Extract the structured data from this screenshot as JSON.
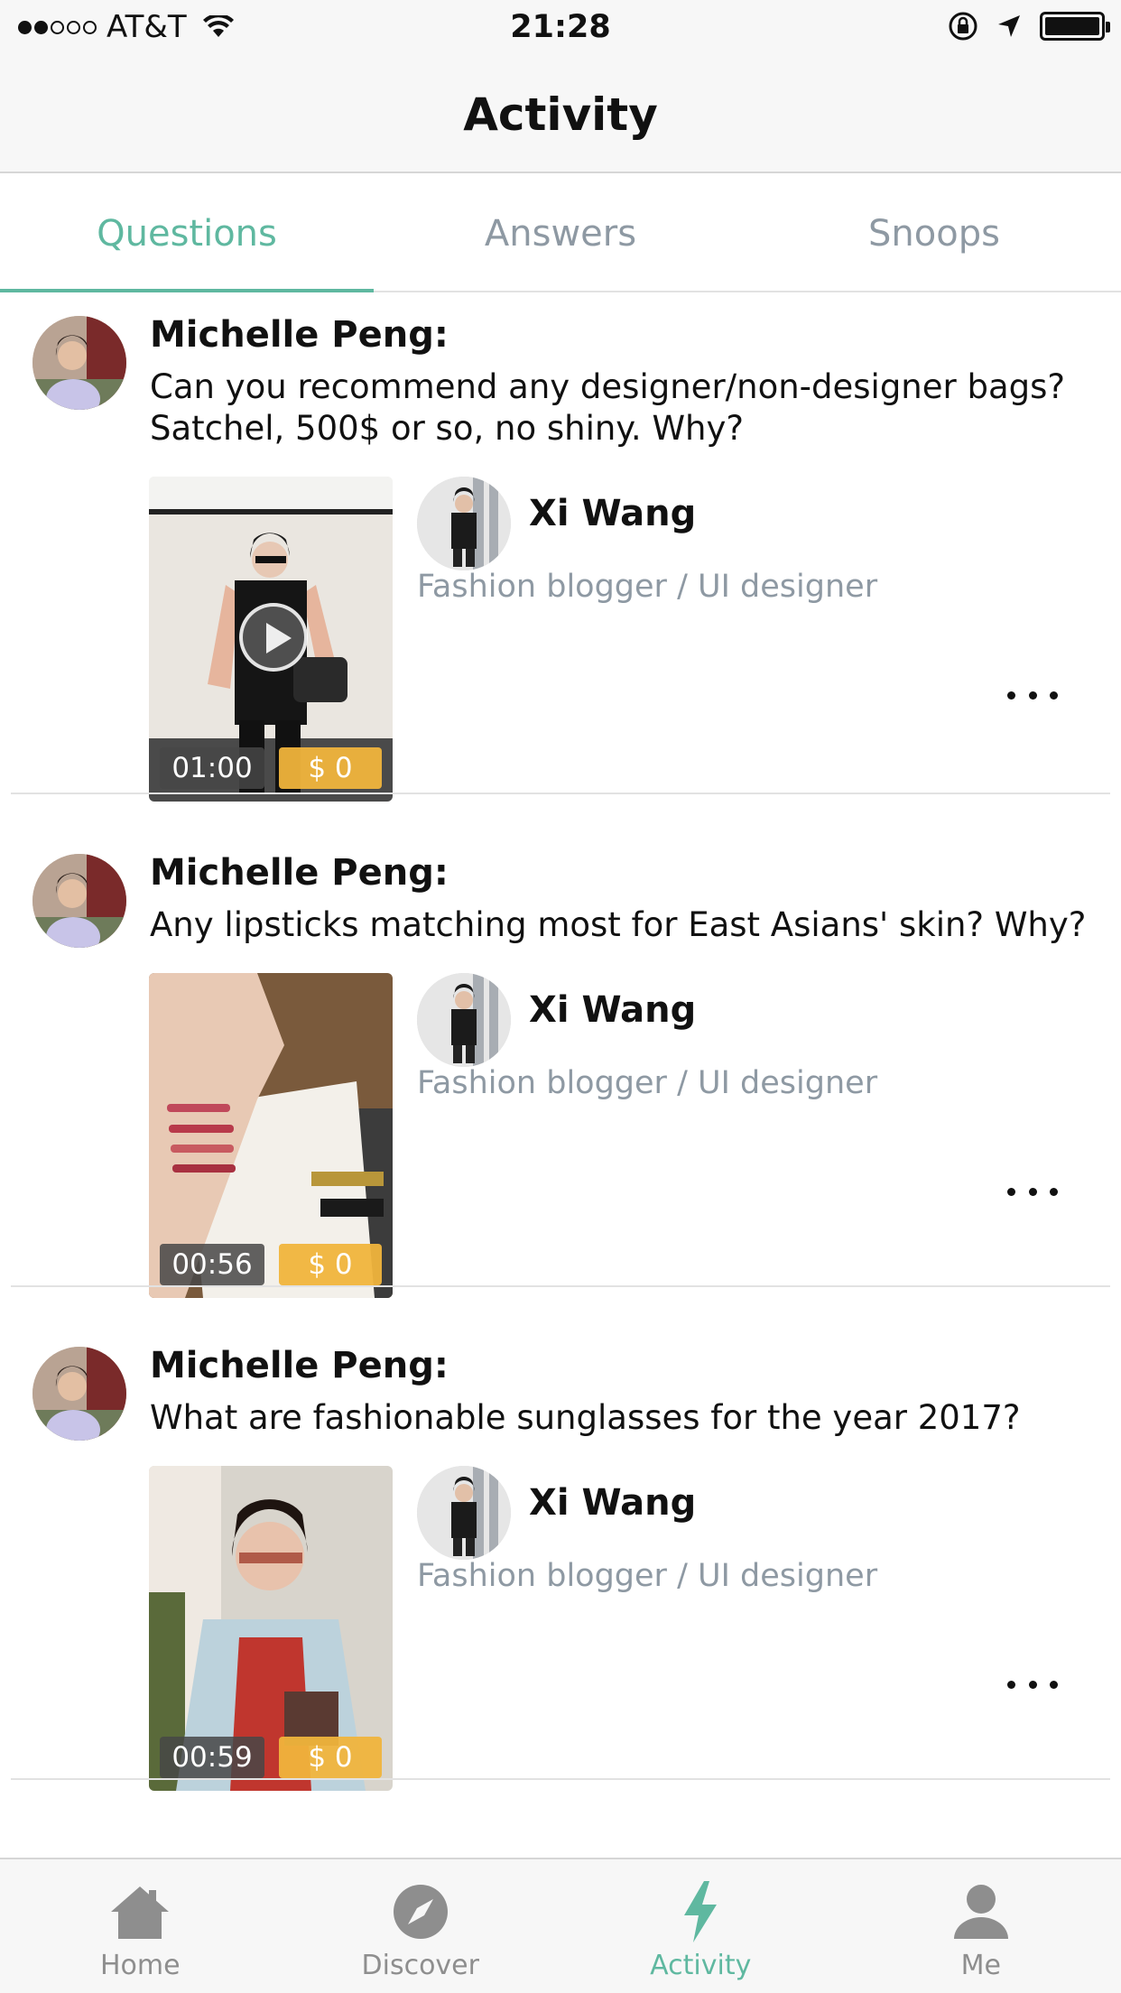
{
  "status_bar": {
    "carrier": "AT&T",
    "time": "21:28",
    "signal_bars_filled": 2,
    "signal_bars_total": 5
  },
  "header": {
    "title": "Activity"
  },
  "tabs": [
    {
      "label": "Questions",
      "active": true
    },
    {
      "label": "Answers",
      "active": false
    },
    {
      "label": "Snoops",
      "active": false
    }
  ],
  "feed": [
    {
      "asker": "Michelle Peng:",
      "question": "Can you recommend any designer/non-designer bags? Satchel, 500$ or so, no shiny. Why?",
      "duration": "01:00",
      "price": "$ 0",
      "answerer": "Xi Wang",
      "answerer_title": "Fashion blogger / UI designer"
    },
    {
      "asker": "Michelle Peng:",
      "question": "Any lipsticks matching most for East Asians' skin? Why?",
      "duration": "00:56",
      "price": "$ 0",
      "answerer": "Xi Wang",
      "answerer_title": "Fashion blogger / UI designer"
    },
    {
      "asker": "Michelle Peng:",
      "question": "What are fashionable sunglasses for the year 2017?",
      "duration": "00:59",
      "price": "$ 0",
      "answerer": "Xi Wang",
      "answerer_title": "Fashion blogger / UI designer"
    }
  ],
  "tab_bar": [
    {
      "label": "Home",
      "icon": "home-icon",
      "active": false
    },
    {
      "label": "Discover",
      "icon": "compass-icon",
      "active": false
    },
    {
      "label": "Activity",
      "icon": "bolt-icon",
      "active": true
    },
    {
      "label": "Me",
      "icon": "person-icon",
      "active": false
    }
  ],
  "colors": {
    "accent": "#5fb8a0",
    "price_badge": "#f0b43c",
    "secondary_text": "#8e99a3"
  }
}
